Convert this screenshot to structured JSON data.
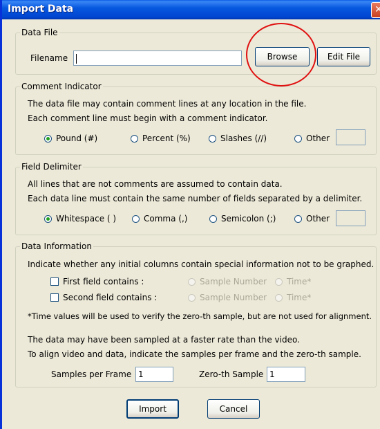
{
  "window": {
    "title": "Import Data",
    "close_glyph": "✕"
  },
  "data_file": {
    "legend": "Data File",
    "filename_label": "Filename",
    "filename_value": "",
    "browse_label": "Browse",
    "edit_label": "Edit File"
  },
  "comment": {
    "legend": "Comment Indicator",
    "line1": "The data file may contain comment lines at any location in the file.",
    "line2": "Each comment line must begin with a comment indicator.",
    "options": [
      "Pound (#)",
      "Percent (%)",
      "Slashes (//)",
      "Other"
    ],
    "selected": 0,
    "other_value": ""
  },
  "delimiter": {
    "legend": "Field Delimiter",
    "line1": "All lines that are not comments are assumed to contain data.",
    "line2": "Each data line must contain the same number of fields separated by a delimiter.",
    "options": [
      "Whitespace ( )",
      "Comma (,)",
      "Semicolon (;)",
      "Other"
    ],
    "selected": 0,
    "other_value": ""
  },
  "info": {
    "legend": "Data Information",
    "line1": "Indicate whether any initial columns contain special information not to be graphed.",
    "first_field_label": "First field contains :",
    "second_field_label": "Second field contains :",
    "sample_number_label": "Sample Number",
    "time_label": "Time*",
    "note": "*Time values will be used to verify the zero-th sample, but are not used for alignment.",
    "rate_line1": "The data may have been sampled at a faster rate than the video.",
    "rate_line2": "To align video and data, indicate the samples per frame and the zero-th sample.",
    "samples_per_frame_label": "Samples per Frame",
    "samples_per_frame_value": "1",
    "zeroth_label": "Zero-th Sample",
    "zeroth_value": "1"
  },
  "buttons": {
    "import_label": "Import",
    "cancel_label": "Cancel"
  },
  "annotation": {
    "circle_color": "#e01010"
  }
}
